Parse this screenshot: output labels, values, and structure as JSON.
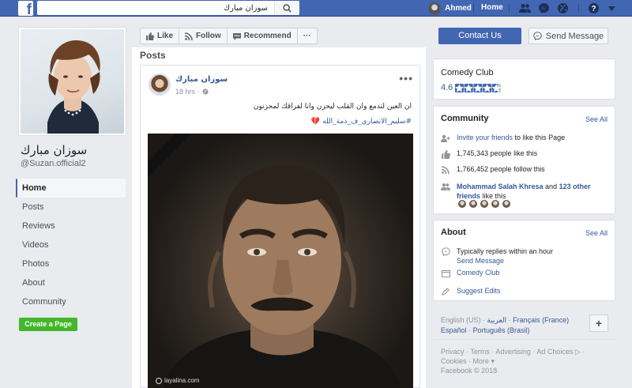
{
  "topbar": {
    "logo": "f",
    "search_value": "سوزان مبارك",
    "user_name": "Ahmed",
    "home_label": "Home",
    "icons": [
      "friends-icon",
      "messenger-icon",
      "globe-icon",
      "help-icon",
      "caret-down-icon"
    ]
  },
  "page": {
    "name": "سوزان مبارك",
    "handle": "@Suzan.official2"
  },
  "left_nav": {
    "items": [
      {
        "label": "Home",
        "active": true
      },
      {
        "label": "Posts",
        "active": false
      },
      {
        "label": "Reviews",
        "active": false
      },
      {
        "label": "Videos",
        "active": false
      },
      {
        "label": "Photos",
        "active": false
      },
      {
        "label": "About",
        "active": false
      },
      {
        "label": "Community",
        "active": false
      }
    ],
    "create_page": "Create a Page"
  },
  "actions": {
    "like": "Like",
    "follow": "Follow",
    "recommend": "Recommend",
    "more": "···",
    "contact": "Contact Us",
    "send_message": "Send Message"
  },
  "posts": {
    "header": "Posts",
    "post": {
      "author": "سوزان مبارك",
      "time": "18 hrs ·",
      "menu": "•••",
      "text": "ان العين لتدمع وان القلب ليحزن وانا لفراقك لمحزنون",
      "hashtag": "#سليم_الانصاري_ف_ذمة_الله",
      "watermark": "layalina.com"
    }
  },
  "about_page": {
    "category": "Comedy Club",
    "rating": "4.6",
    "stars": 4.6
  },
  "community": {
    "title": "Community",
    "see_all": "See All",
    "invite_link": "Invite your friends",
    "invite_rest": " to like this Page",
    "likes": "1,745,343 people like this",
    "follows": "1,766,452 people follow this",
    "friend_name": "Mohammad Salah Khresa",
    "friend_and": " and ",
    "other_friends": "123 other friends",
    "friend_rest": " like this"
  },
  "about": {
    "title": "About",
    "see_all": "See All",
    "replies": "Typically replies within an hour",
    "send_message": "Send Message",
    "category": "Comedy Club",
    "suggest": "Suggest Edits"
  },
  "languages": {
    "current": "English (US)",
    "sep": " · ",
    "arabic": "العربية",
    "french": "Français (France)",
    "spanish": "Español",
    "portuguese": "Português (Brasil)",
    "add": "+"
  },
  "footer": {
    "privacy": "Privacy",
    "terms": "Terms",
    "advertising": "Advertising",
    "ad_choices": "Ad Choices",
    "cookies": "Cookies",
    "more": "More",
    "copyright": "Facebook © 2018"
  },
  "colors": {
    "brand": "#4267b2",
    "link": "#365899",
    "create_button": "#42b72a",
    "background": "#e9ebee"
  }
}
